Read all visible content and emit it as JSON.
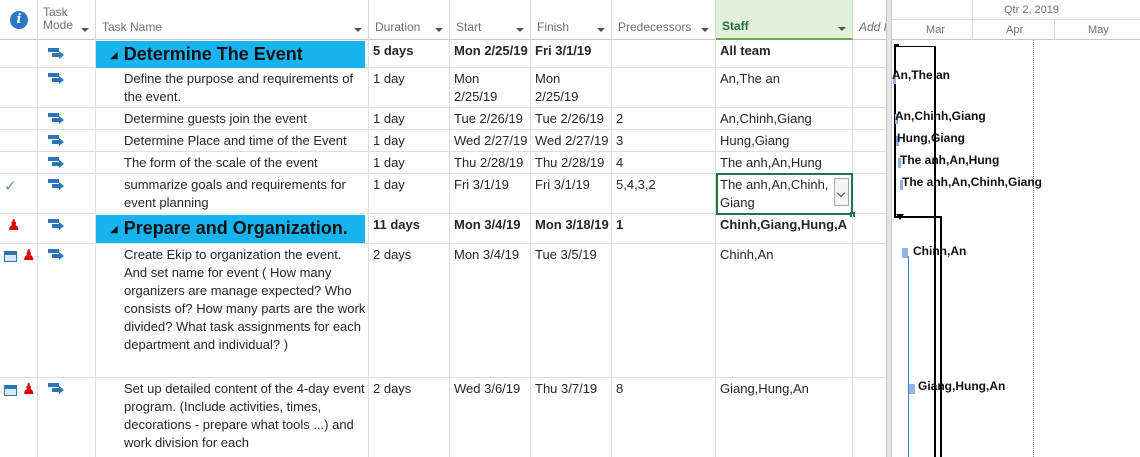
{
  "columns": {
    "info_tooltip": "i",
    "task_mode_line1": "Task",
    "task_mode_line2": "Mode",
    "task_name": "Task Name",
    "duration": "Duration",
    "start": "Start",
    "finish": "Finish",
    "predecessors": "Predecessors",
    "staff": "Staff",
    "add_new": "Add N"
  },
  "tasks": [
    {
      "name": "Determine The Event",
      "duration": "5 days",
      "start": "Mon 2/25/19",
      "finish": "Fri 3/1/19",
      "pred": "",
      "staff": "All team"
    },
    {
      "name": "Define the purpose and requirements of the event.",
      "duration": "1 day",
      "start": "Mon 2/25/19",
      "finish": "Mon 2/25/19",
      "pred": "",
      "staff": "An,The an"
    },
    {
      "name": "Determine guests join the event",
      "duration": "1 day",
      "start": "Tue 2/26/19",
      "finish": "Tue 2/26/19",
      "pred": "2",
      "staff": "An,Chinh,Giang"
    },
    {
      "name": "Determine Place and time of the Event",
      "duration": "1 day",
      "start": "Wed 2/27/19",
      "finish": "Wed 2/27/19",
      "pred": "3",
      "staff": "Hung,Giang"
    },
    {
      "name": "The form of the scale of the event",
      "duration": "1 day",
      "start": "Thu 2/28/19",
      "finish": "Thu 2/28/19",
      "pred": "4",
      "staff": "The anh,An,Hung"
    },
    {
      "name": "summarize goals and requirements for event planning",
      "duration": "1 day",
      "start": "Fri 3/1/19",
      "finish": "Fri 3/1/19",
      "pred": "5,4,3,2",
      "staff": "The anh,An,Chinh, Giang"
    },
    {
      "name": "Prepare and Organization.",
      "duration": "11 days",
      "start": "Mon 3/4/19",
      "finish": "Mon 3/18/19",
      "pred": "1",
      "staff": "Chinh,Giang,Hung,A"
    },
    {
      "name": "Create Ekip to organization the event. And set name for event ( How many organizers are  manage expected? Who consists of? How many parts are the work divided?  What task assignments for each department and individual? )",
      "duration": "2 days",
      "start": "Mon 3/4/19",
      "finish": "Tue 3/5/19",
      "pred": "",
      "staff": "Chinh,An"
    },
    {
      "name": "Set up detailed content of the 4-day event program. (Include activities, times, decorations - prepare what tools ...) and work division for each",
      "duration": "2 days",
      "start": "Wed 3/6/19",
      "finish": "Thu 3/7/19",
      "pred": "8",
      "staff": "Giang,Hung,An"
    }
  ],
  "timescale": {
    "quarter": "Qtr 2, 2019",
    "months": [
      "Mar",
      "Apr",
      "May"
    ]
  },
  "bar_labels": [
    "An,The an",
    "An,Chinh,Giang",
    "Hung,Giang",
    "The anh,An,Hung",
    "The anh,An,Chinh,Giang",
    "Chinh,An",
    "Giang,Hung,An"
  ],
  "colors": {
    "summary_fill": "#17b3ee",
    "staff_header": "#e2efda",
    "accent_green": "#217346",
    "bar_blue": "#8db4e2"
  }
}
